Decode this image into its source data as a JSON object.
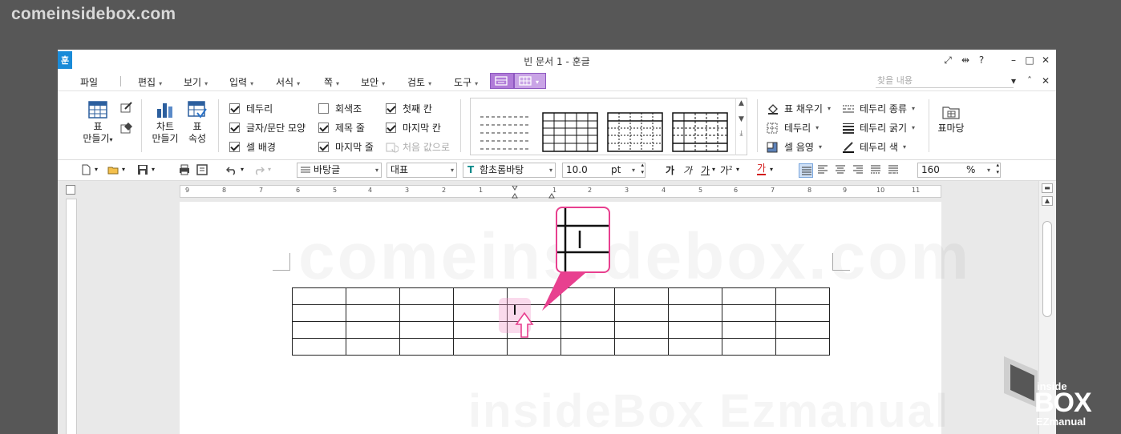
{
  "watermark": {
    "top": "comeinsidebox.com",
    "center": "comeinsidebox.com",
    "bottom": "insideBox Ezmanual"
  },
  "titlebar": {
    "app_icon": "훈",
    "title": "빈 문서 1 - 훈글",
    "help": "?"
  },
  "menu": {
    "file": "파일",
    "items": [
      "편집",
      "보기",
      "입력",
      "서식",
      "쪽",
      "보안",
      "검토",
      "도구"
    ],
    "search_placeholder": "찾을 내용"
  },
  "ribbon": {
    "table_make": [
      "표",
      "만들기"
    ],
    "chart_make": [
      "차트",
      "만들기"
    ],
    "table_props": [
      "표",
      "속성"
    ],
    "checks": [
      {
        "label": "테두리",
        "checked": true
      },
      {
        "label": "글자/문단 모양",
        "checked": true
      },
      {
        "label": "셀 배경",
        "checked": true
      },
      {
        "label": "회색조",
        "checked": false
      },
      {
        "label": "제목 줄",
        "checked": true
      },
      {
        "label": "마지막 줄",
        "checked": true
      },
      {
        "label": "첫째 칸",
        "checked": true
      },
      {
        "label": "마지막 칸",
        "checked": true
      }
    ],
    "reset": "처음 값으로",
    "fill": "표 채우기",
    "border": "테두리",
    "cell_shade": "셀 음영",
    "border_type": "테두리 종류",
    "border_width": "테두리 굵기",
    "border_color": "테두리 색",
    "table_madang": "표마당"
  },
  "toolbar2": {
    "style": "바탕글",
    "para_style": "대표",
    "font": "함초롬바탕",
    "font_size": "10.0",
    "unit": "pt",
    "fmt": [
      "가",
      "가",
      "가",
      "가",
      "가"
    ],
    "zoom": "160",
    "zoom_unit": "%"
  },
  "ruler": [
    "9",
    "8",
    "7",
    "6",
    "5",
    "4",
    "3",
    "2",
    "1",
    "1",
    "2",
    "3",
    "4",
    "5",
    "6",
    "7",
    "8",
    "9",
    "10",
    "11"
  ],
  "logo": {
    "inside": "inside",
    "box": "BOX",
    "ez": "EZmanual"
  },
  "colors": {
    "accent": "#e8408f",
    "tool_tab": "#b07bd8",
    "app_logo": "#1a8bd8"
  }
}
